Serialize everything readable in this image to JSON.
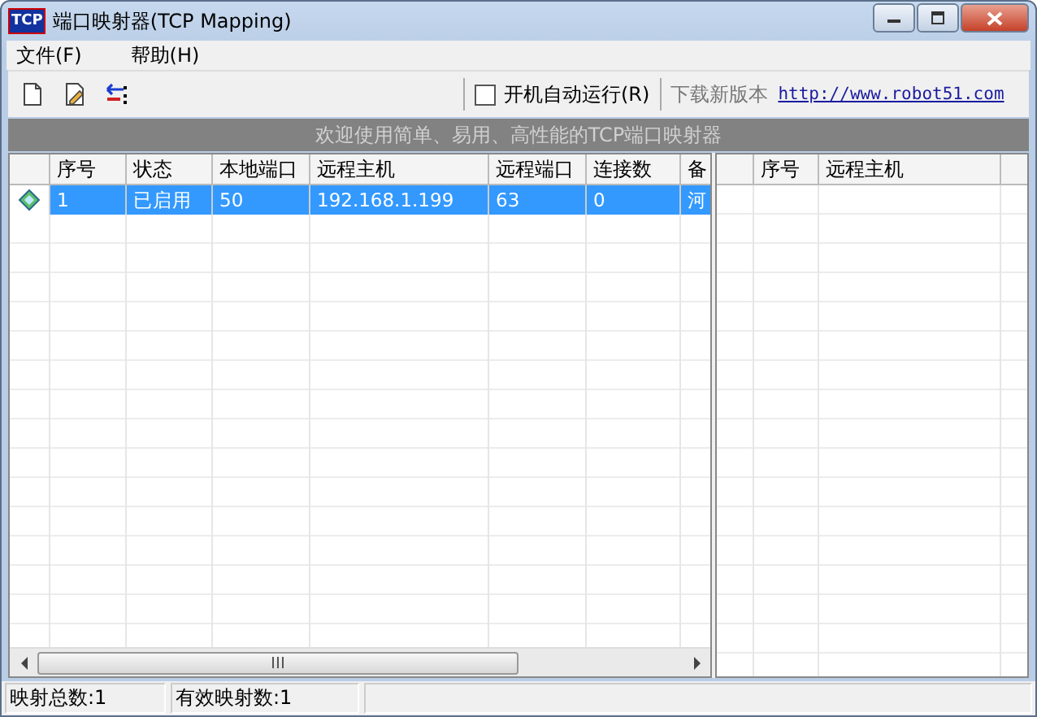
{
  "window": {
    "icon_text": "TCP",
    "title": "端口映射器(TCP Mapping)"
  },
  "menu": [
    "文件(F)",
    "帮助(H)"
  ],
  "toolbar": {
    "autostart": {
      "label": "开机自动运行(R)",
      "checked": false
    },
    "download_label": "下载新版本",
    "link": "http://www.robot51.com"
  },
  "banner": "欢迎使用简单、易用、高性能的TCP端口映射器",
  "mapping_table": {
    "columns": [
      "序号",
      "状态",
      "本地端口",
      "远程主机",
      "远程端口",
      "连接数",
      "备"
    ],
    "rows": [
      {
        "cells": [
          "1",
          "已启用",
          "50",
          "192.168.1.199",
          "63",
          "0",
          "河"
        ],
        "selected": true
      }
    ]
  },
  "connection_table": {
    "columns": [
      "序号",
      "远程主机"
    ]
  },
  "status_bar": [
    "映射总数:1",
    "有效映射数:1"
  ]
}
